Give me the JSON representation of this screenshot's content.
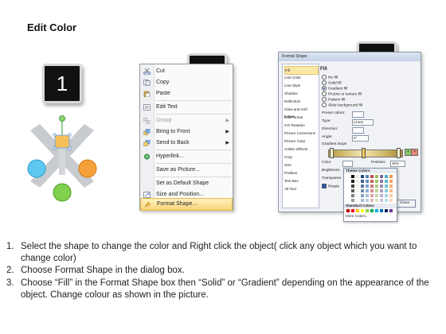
{
  "page": {
    "title": "Edit Color"
  },
  "steps": {
    "one": "1",
    "two": "2",
    "three": "3"
  },
  "context_menu": {
    "items": [
      {
        "label": "Cut",
        "icon": "scissors-icon",
        "enabled": true
      },
      {
        "label": "Copy",
        "icon": "copy-icon",
        "enabled": true
      },
      {
        "label": "Paste",
        "icon": "paste-icon",
        "enabled": true
      },
      {
        "label": "Edit Text",
        "icon": "edit-text-icon",
        "enabled": true
      },
      {
        "label": "Group",
        "icon": "group-icon",
        "enabled": false,
        "submenu": true
      },
      {
        "label": "Bring to Front",
        "icon": "bring-front-icon",
        "enabled": true,
        "submenu": true
      },
      {
        "label": "Send to Back",
        "icon": "send-back-icon",
        "enabled": true,
        "submenu": true
      },
      {
        "label": "Hyperlink...",
        "icon": "hyperlink-icon",
        "enabled": true
      },
      {
        "label": "Save as Picture...",
        "icon": "",
        "enabled": true
      },
      {
        "label": "Set as Default Shape",
        "icon": "",
        "enabled": true
      },
      {
        "label": "Size and Position...",
        "icon": "size-icon",
        "enabled": true
      },
      {
        "label": "Format Shape...",
        "icon": "format-shape-icon",
        "enabled": true,
        "highlighted": true
      }
    ]
  },
  "format_dialog": {
    "title": "Format Shape",
    "nav_items": [
      "Fill",
      "Line Color",
      "Line Style",
      "Shadow",
      "Reflection",
      "Glow and Soft Edges",
      "3-D Format",
      "3-D Rotation",
      "Picture Corrections",
      "Picture Color",
      "Artistic Effects",
      "Crop",
      "Size",
      "Position",
      "Text Box",
      "Alt Text"
    ],
    "section_heading": "Fill",
    "fill_options": [
      "No fill",
      "Solid fill",
      "Gradient fill",
      "Picture or texture fill",
      "Pattern fill",
      "Slide background fill"
    ],
    "selected_fill": "Gradient fill",
    "preset_colors_label": "Preset colors:",
    "type_label": "Type:",
    "type_value": "Linear",
    "direction_label": "Direction:",
    "angle_label": "Angle:",
    "angle_value": "0°",
    "gradient_stops_label": "Gradient stops",
    "color_label": "Color",
    "position_label": "Position:",
    "position_value": "46%",
    "brightness_label": "Brightness",
    "transparency_label": "Transparen",
    "rotate_label": "Rotate",
    "close_label": "Close",
    "theme_colors_label": "Theme Colors",
    "standard_colors_label": "Standard Colors",
    "more_colors_label": "More Colors...",
    "accent": "#f3c95a"
  },
  "instructions": [
    {
      "num": "1.",
      "text": "Select the shape to change the color and Right click the object( click any object which you want to change color)"
    },
    {
      "num": "2.",
      "text": "Choose Format Shape in the dialog box."
    },
    {
      "num": "3.",
      "text": "Choose “Fill” in the Format Shape box then “Solid” or “Gradient” depending on the appearance of the object. Change colour as shown in the picture."
    }
  ]
}
